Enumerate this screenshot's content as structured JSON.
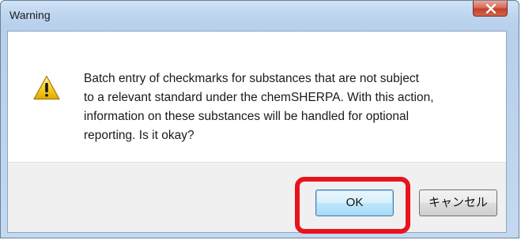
{
  "window": {
    "title": "Warning"
  },
  "icons": {
    "close": "close-icon",
    "warning": "warning-icon"
  },
  "message": {
    "text": "Batch entry of checkmarks for substances that are not subject\nto a relevant standard under the chemSHERPA. With this action,\ninformation on these substances will be handled for optional\nreporting. Is it okay?"
  },
  "buttons": {
    "ok_label": "OK",
    "cancel_label": "キャンセル"
  },
  "colors": {
    "highlight": "#e8141d",
    "close_button": "#c2402a"
  }
}
